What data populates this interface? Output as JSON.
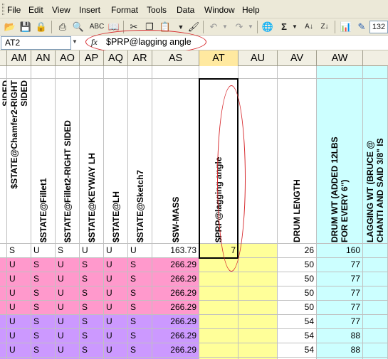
{
  "menu": [
    "File",
    "Edit",
    "View",
    "Insert",
    "Format",
    "Tools",
    "Data",
    "Window",
    "Help"
  ],
  "toolbar": {
    "zoom": "132"
  },
  "formula_bar": {
    "name_box": "AT2",
    "fx": "fx",
    "formula": "$PRP@lagging angle"
  },
  "columns": [
    "AM",
    "AN",
    "AO",
    "AP",
    "AQ",
    "AR",
    "AS",
    "AT",
    "AU",
    "AV",
    "AW"
  ],
  "selected_column": "AT",
  "header_row": [
    {
      "col": "AL",
      "text": "SIDED",
      "extra": "SIDED"
    },
    {
      "col": "AM",
      "text": "$STATE@Chamfer2-RIGHT",
      "extra": "SIDED"
    },
    {
      "col": "AN",
      "text": "$STATE@Fillet1"
    },
    {
      "col": "AO",
      "text": "$STATE@Fillet2-RIGHT SIDED"
    },
    {
      "col": "AP",
      "text": "$STATE@KEYWAY LH"
    },
    {
      "col": "AQ",
      "text": "$STATE@LH"
    },
    {
      "col": "AR",
      "text": "$STATE@Sketch7"
    },
    {
      "col": "AS",
      "text": "$SW-MASS"
    },
    {
      "col": "AT",
      "text": "$PRP@lagging angle"
    },
    {
      "col": "AU",
      "text": ""
    },
    {
      "col": "AV",
      "text": "DRUM LENGTH"
    },
    {
      "col": "AW",
      "text": "DRUM WT (ADDED 12LBS",
      "extra": "FOR EVERY 6\")"
    },
    {
      "col": "AX",
      "text": "LAGGING WT (BRUCE @",
      "extra": "CHANTI AND SAID 3/8\" IS"
    }
  ],
  "rows": [
    {
      "bg": "#ffffff",
      "c": [
        "S",
        "U",
        "S",
        "U",
        "U",
        "U"
      ],
      "mass": "163.73",
      "at": "7",
      "len": "26",
      "wt": "160"
    },
    {
      "bg": "#ff99cc",
      "c": [
        "U",
        "S",
        "U",
        "S",
        "U",
        "S"
      ],
      "mass": "266.29",
      "at": "",
      "len": "50",
      "wt": "77"
    },
    {
      "bg": "#ff99cc",
      "c": [
        "U",
        "S",
        "U",
        "S",
        "U",
        "S"
      ],
      "mass": "266.29",
      "at": "",
      "len": "50",
      "wt": "77"
    },
    {
      "bg": "#ff99cc",
      "c": [
        "U",
        "S",
        "U",
        "S",
        "U",
        "S"
      ],
      "mass": "266.29",
      "at": "",
      "len": "50",
      "wt": "77"
    },
    {
      "bg": "#ff99cc",
      "c": [
        "U",
        "S",
        "U",
        "S",
        "U",
        "S"
      ],
      "mass": "266.29",
      "at": "",
      "len": "50",
      "wt": "77"
    },
    {
      "bg": "#cc99ff",
      "c": [
        "U",
        "S",
        "U",
        "S",
        "U",
        "S"
      ],
      "mass": "266.29",
      "at": "",
      "len": "54",
      "wt": "77"
    },
    {
      "bg": "#cc99ff",
      "c": [
        "U",
        "S",
        "U",
        "S",
        "U",
        "S"
      ],
      "mass": "266.29",
      "at": "",
      "len": "54",
      "wt": "88"
    },
    {
      "bg": "#cc99ff",
      "c": [
        "U",
        "S",
        "U",
        "S",
        "U",
        "S"
      ],
      "mass": "266.29",
      "at": "",
      "len": "54",
      "wt": "88"
    },
    {
      "bg": "#cc99ff",
      "c": [
        "U",
        "S",
        "U",
        "S",
        "U",
        "S"
      ],
      "mass": "266.29",
      "at": "",
      "len": "54",
      "wt": "88"
    }
  ],
  "colors": {
    "yellow": "#ffff99",
    "cyan": "#ccffff",
    "pink": "#ff99cc",
    "purple": "#cc99ff",
    "annotation": "#d6262a"
  }
}
